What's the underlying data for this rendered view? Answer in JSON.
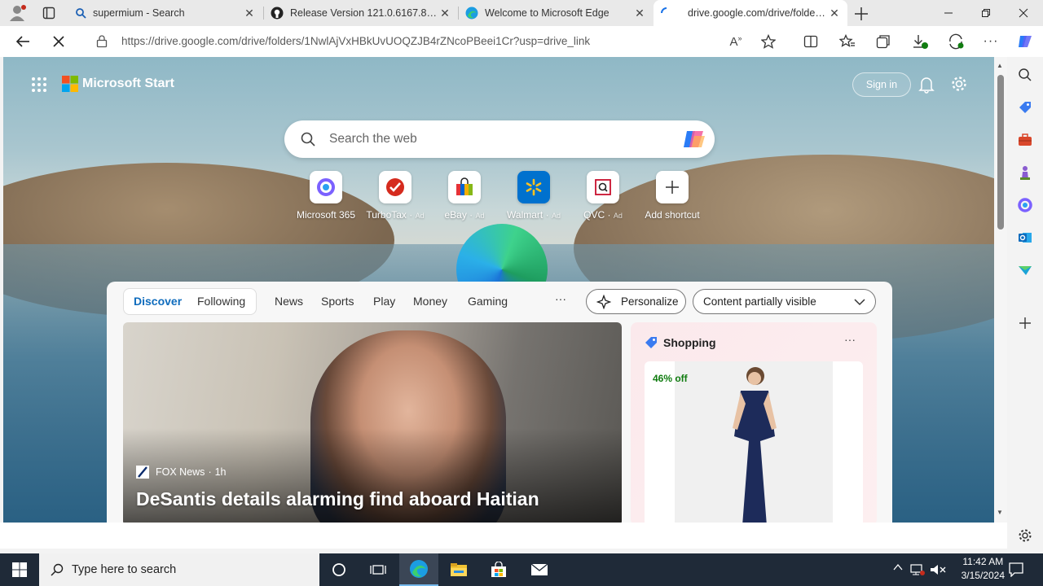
{
  "tabs": [
    {
      "title": "supermium - Search",
      "icon": "search-icon"
    },
    {
      "title": "Release Version 121.0.6167.81 H",
      "icon": "github-icon"
    },
    {
      "title": "Welcome to Microsoft Edge",
      "icon": "edge-icon"
    },
    {
      "title": "drive.google.com/drive/folders/1",
      "icon": "loading-icon"
    }
  ],
  "address": {
    "url": "https://drive.google.com/drive/folders/1NwlAjVxHBkUvUOQZJB4rZNcoPBeei1Cr?usp=drive_link"
  },
  "newtab": {
    "brand": "Microsoft Start",
    "sign_in": "Sign in",
    "search_placeholder": "Search the web",
    "shortcuts": [
      {
        "label": "Microsoft 365",
        "ad": ""
      },
      {
        "label": "TurboTax",
        "ad": "Ad"
      },
      {
        "label": "eBay",
        "ad": "Ad"
      },
      {
        "label": "Walmart",
        "ad": "Ad"
      },
      {
        "label": "QVC",
        "ad": "Ad"
      },
      {
        "label": "Add shortcut",
        "ad": ""
      }
    ]
  },
  "feed": {
    "tabs": [
      "Discover",
      "Following"
    ],
    "nav": [
      "News",
      "Sports",
      "Play",
      "Money",
      "Gaming"
    ],
    "more": "···",
    "personalize": "Personalize",
    "visibility": "Content partially visible",
    "hero": {
      "source": "FOX News",
      "age": "1h",
      "headline": "DeSantis details alarming find aboard Haitian"
    },
    "shopping": {
      "title": "Shopping",
      "more": "···",
      "discount": "46% off"
    }
  },
  "taskbar": {
    "search_placeholder": "Type here to search",
    "time": "11:42 AM",
    "date": "3/15/2024"
  },
  "colors": {
    "accent": "#0f6cbd",
    "taskbar": "#1f2a38"
  }
}
